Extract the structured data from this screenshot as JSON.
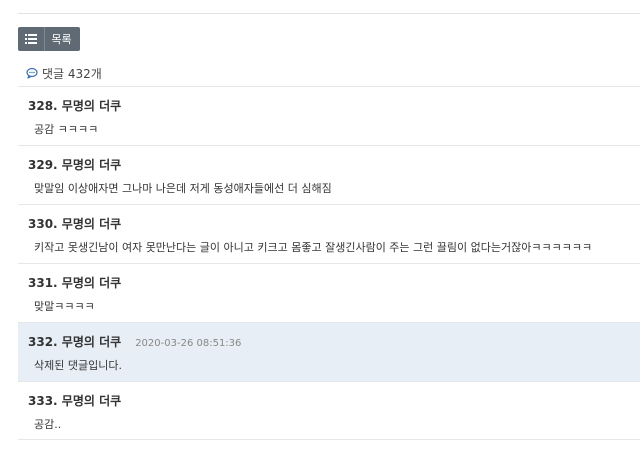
{
  "toolbar": {
    "list_button_label": "목록",
    "list_icon": "list-icon"
  },
  "comments_header": {
    "icon": "speech-bubble-icon",
    "label": "댓글 432개",
    "accent": "#3b6fb6"
  },
  "comments": [
    {
      "number": "328.",
      "author": "무명의 더쿠",
      "timestamp": "",
      "text": "공감 ㅋㅋㅋㅋ"
    },
    {
      "number": "329.",
      "author": "무명의 더쿠",
      "timestamp": "",
      "text": "맞말임 이상애자면 그나마 나은데 저게 동성애자들에선 더 심해짐"
    },
    {
      "number": "330.",
      "author": "무명의 더쿠",
      "timestamp": "",
      "text": "키작고 못생긴남이 여자 못만난다는 글이 아니고 키크고 몸좋고 잘생긴사람이 주는 그런 끌림이 없다는거잖아ㅋㅋㅋㅋㅋㅋ"
    },
    {
      "number": "331.",
      "author": "무명의 더쿠",
      "timestamp": "",
      "text": "맞말ㅋㅋㅋㅋ"
    },
    {
      "number": "332.",
      "author": "무명의 더쿠",
      "timestamp": "2020-03-26 08:51:36",
      "text": "삭제된 댓글입니다."
    },
    {
      "number": "333.",
      "author": "무명의 더쿠",
      "timestamp": "",
      "text": "공감.."
    }
  ],
  "colors": {
    "button_bg": "#5f6a75",
    "highlight_bg": "#e8eef5",
    "divider": "#e6e6e6"
  }
}
